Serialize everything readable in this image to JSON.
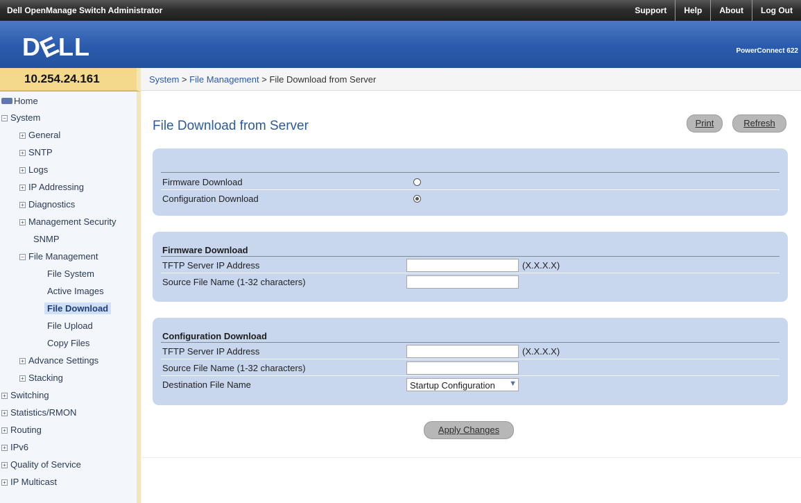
{
  "header": {
    "app_title": "Dell OpenManage Switch Administrator",
    "links": [
      "Support",
      "Help",
      "About",
      "Log Out"
    ]
  },
  "brand": {
    "logo_left": "D",
    "logo_e": "E",
    "logo_right": "LL",
    "product": "PowerConnect 622"
  },
  "device_ip": "10.254.24.161",
  "breadcrumb": {
    "system": "System",
    "sep1": " > ",
    "file_mgmt": "File Management",
    "sep2": " > ",
    "current": "File Download from Server"
  },
  "nav": {
    "home": "Home",
    "system": "System",
    "general": "General",
    "sntp": "SNTP",
    "logs": "Logs",
    "ip_addressing": "IP Addressing",
    "diagnostics": "Diagnostics",
    "mgmt_security": "Management Security",
    "snmp": "SNMP",
    "file_management": "File Management",
    "file_system": "File System",
    "active_images": "Active Images",
    "file_download": "File Download",
    "file_upload": "File Upload",
    "copy_files": "Copy Files",
    "advance_settings": "Advance Settings",
    "stacking": "Stacking",
    "switching": "Switching",
    "statistics": "Statistics/RMON",
    "routing": "Routing",
    "ipv6": "IPv6",
    "qos": "Quality of Service",
    "ip_multicast": "IP Multicast"
  },
  "page": {
    "title": "File Download from Server",
    "print": "Print",
    "refresh": "Refresh",
    "apply": "Apply Changes"
  },
  "selection": {
    "firmware_label": "Firmware Download",
    "firmware_selected": false,
    "config_label": "Configuration Download",
    "config_selected": true
  },
  "firmware": {
    "heading": "Firmware Download",
    "tftp_label": "TFTP Server IP Address",
    "tftp_value": "",
    "tftp_hint": "(X.X.X.X)",
    "source_label": "Source File Name (1-32 characters)",
    "source_value": ""
  },
  "config": {
    "heading": "Configuration Download",
    "tftp_label": "TFTP Server IP Address",
    "tftp_value": "",
    "tftp_hint": "(X.X.X.X)",
    "source_label": "Source File Name (1-32 characters)",
    "source_value": "",
    "dest_label": "Destination File Name",
    "dest_value": "Startup Configuration"
  }
}
